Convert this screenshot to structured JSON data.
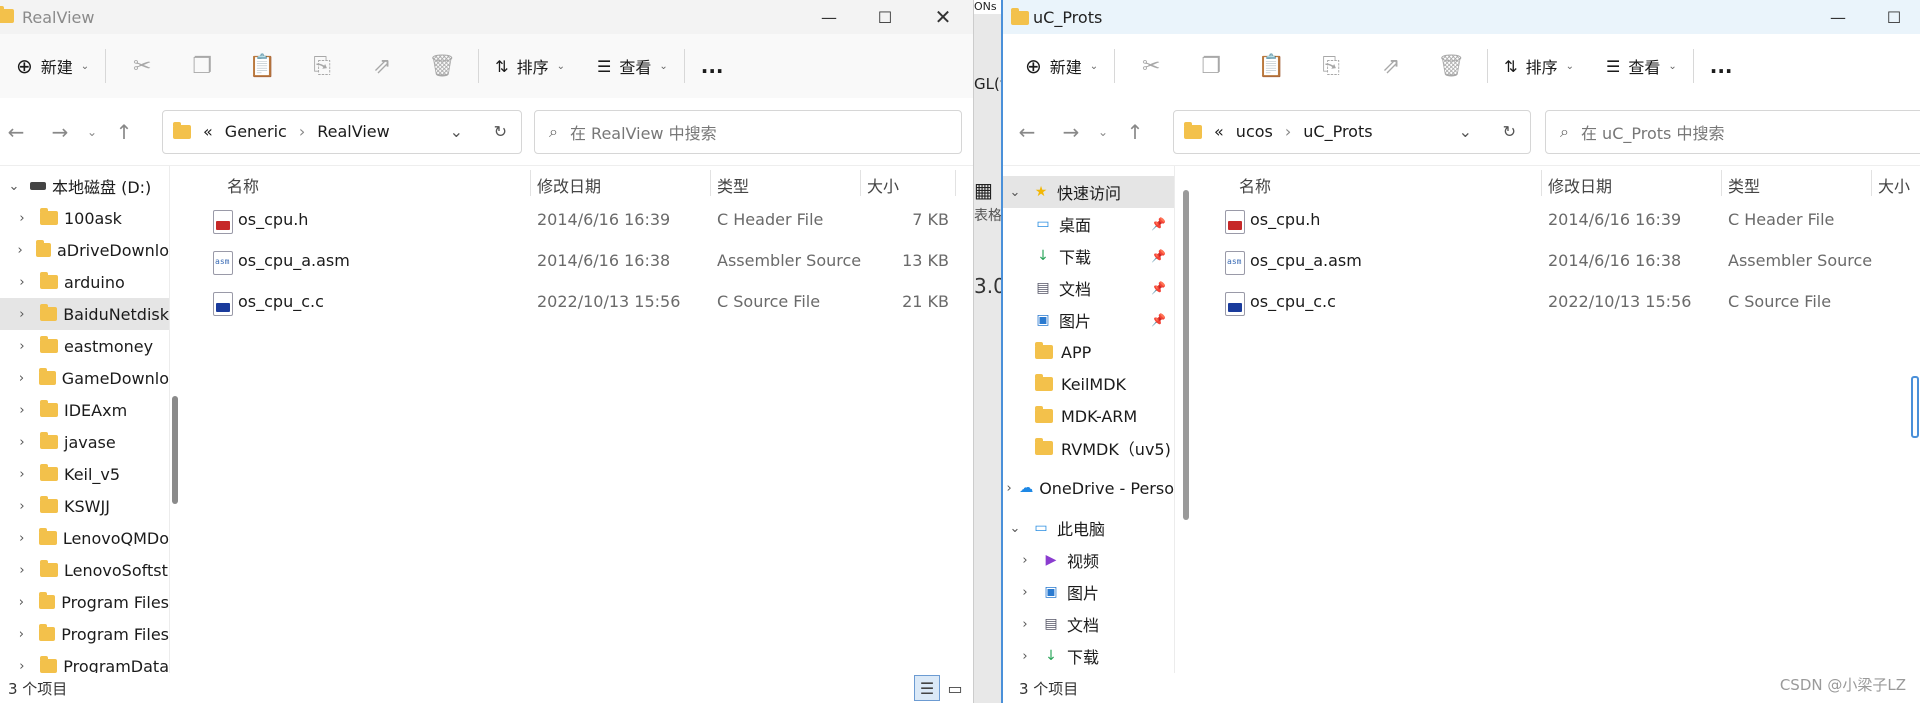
{
  "left_window": {
    "title": "RealView",
    "toolbar": {
      "new_label": "新建",
      "sort_label": "排序",
      "view_label": "查看",
      "more_label": "..."
    },
    "address": {
      "crumbs": [
        "Generic",
        "RealView"
      ],
      "prefix": "«"
    },
    "search_placeholder": "在 RealView 中搜索",
    "tree": [
      {
        "label": "本地磁盘 (D:)",
        "expanded": true
      },
      {
        "label": "100ask"
      },
      {
        "label": "aDriveDownlo"
      },
      {
        "label": "arduino"
      },
      {
        "label": "BaiduNetdisk",
        "selected": true
      },
      {
        "label": "eastmoney"
      },
      {
        "label": "GameDownlo"
      },
      {
        "label": "IDEAxm"
      },
      {
        "label": "javase"
      },
      {
        "label": "Keil_v5"
      },
      {
        "label": "KSWJJ"
      },
      {
        "label": "LenovoQMDo"
      },
      {
        "label": "LenovoSoftst"
      },
      {
        "label": "Program Files"
      },
      {
        "label": "Program Files"
      },
      {
        "label": "ProgramData"
      }
    ],
    "columns": [
      "名称",
      "修改日期",
      "类型",
      "大小"
    ],
    "files": [
      {
        "name": "os_cpu.h",
        "date": "2014/6/16 16:39",
        "type": "C Header File",
        "size": "7 KB",
        "kind": "h"
      },
      {
        "name": "os_cpu_a.asm",
        "date": "2014/6/16 16:38",
        "type": "Assembler Source",
        "size": "13 KB",
        "kind": "asm"
      },
      {
        "name": "os_cpu_c.c",
        "date": "2022/10/13 15:56",
        "type": "C Source File",
        "size": "21 KB",
        "kind": "c"
      }
    ],
    "status": "3 个项目"
  },
  "background_strip": {
    "lines": [
      "GL(v",
      "表格",
      "3.0"
    ]
  },
  "right_window": {
    "title": "uC_Prots",
    "toolbar": {
      "new_label": "新建",
      "sort_label": "排序",
      "view_label": "查看",
      "more_label": "..."
    },
    "address": {
      "crumbs": [
        "ucos",
        "uC_Prots"
      ],
      "prefix": "«"
    },
    "search_placeholder": "在 uC_Prots 中搜索",
    "tree": [
      {
        "label": "快速访问",
        "icon": "star-icon",
        "expanded": true,
        "selected": true
      },
      {
        "label": "桌面",
        "icon": "desktop-icon",
        "pinned": true
      },
      {
        "label": "下载",
        "icon": "download-icon",
        "pinned": true
      },
      {
        "label": "文档",
        "icon": "document-icon",
        "pinned": true
      },
      {
        "label": "图片",
        "icon": "picture-icon",
        "pinned": true
      },
      {
        "label": "APP",
        "icon": "folder-icon"
      },
      {
        "label": "KeilMDK",
        "icon": "folder-icon"
      },
      {
        "label": "MDK-ARM",
        "icon": "folder-icon"
      },
      {
        "label": "RVMDK（uv5)",
        "icon": "folder-icon"
      },
      {
        "label": "OneDrive - Perso",
        "icon": "cloud-icon"
      },
      {
        "label": "此电脑",
        "icon": "computer-icon",
        "expanded": true
      },
      {
        "label": "视频",
        "icon": "video-icon"
      },
      {
        "label": "图片",
        "icon": "picture-icon"
      },
      {
        "label": "文档",
        "icon": "document-icon"
      },
      {
        "label": "下载",
        "icon": "download-icon"
      }
    ],
    "columns": [
      "名称",
      "修改日期",
      "类型",
      "大小"
    ],
    "files": [
      {
        "name": "os_cpu.h",
        "date": "2014/6/16 16:39",
        "type": "C Header File",
        "kind": "h"
      },
      {
        "name": "os_cpu_a.asm",
        "date": "2014/6/16 16:38",
        "type": "Assembler Source",
        "kind": "asm"
      },
      {
        "name": "os_cpu_c.c",
        "date": "2022/10/13 15:56",
        "type": "C Source File",
        "kind": "c"
      }
    ],
    "status": "3 个项目"
  },
  "watermark": "CSDN @小梁子LZ",
  "colors": {
    "folder": "#f3c14b",
    "accent": "#0067c0",
    "selected": "#e5e5e5",
    "h_icon": "#c62828",
    "c_icon": "#1a3b9c"
  }
}
